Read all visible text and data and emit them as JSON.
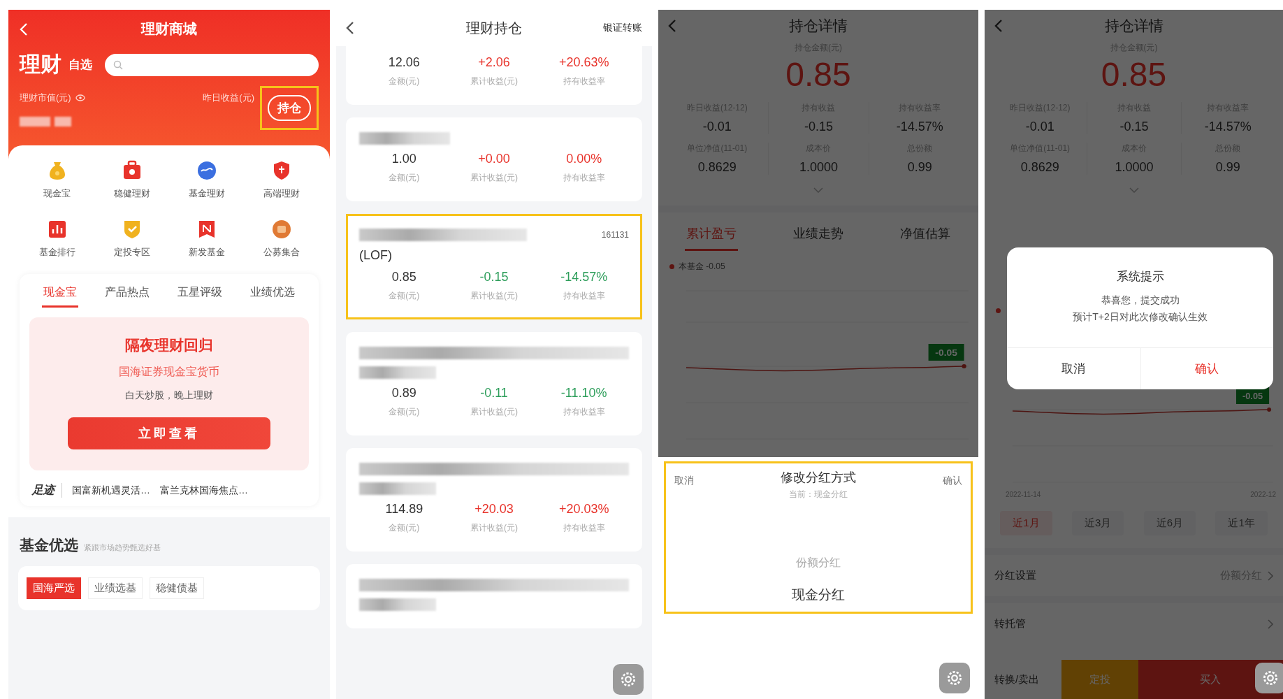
{
  "mall": {
    "title": "理财商城",
    "brand": "理财",
    "watchlist": "自选",
    "market_value_label": "理财市值(元)",
    "yesterday_label": "昨日收益(元)",
    "holdings_button": {
      "label": "持仓",
      "highlighted": true
    },
    "shortcuts": [
      "现金宝",
      "稳健理财",
      "基金理财",
      "高端理财",
      "基金排行",
      "定投专区",
      "新发基金",
      "公募集合"
    ],
    "tabs": [
      {
        "label": "现金宝",
        "selected": true
      },
      {
        "label": "产品热点",
        "selected": false
      },
      {
        "label": "五星评级",
        "selected": false
      },
      {
        "label": "业绩优选",
        "selected": false
      }
    ],
    "promo": {
      "title": "隔夜理财回归",
      "product": "国海证券现金宝货币",
      "slogan": "白天炒股，晚上理财",
      "button": "立即查看"
    },
    "footprints": {
      "label": "足迹",
      "items": [
        "国富新机遇灵活…",
        "富兰克林国海焦点…"
      ]
    },
    "section": {
      "title": "基金优选",
      "subtitle": "紧跟市场趋势甄选好基"
    },
    "chips": [
      {
        "label": "国海严选",
        "selected": true
      },
      {
        "label": "业绩选基",
        "selected": false
      },
      {
        "label": "稳健债基",
        "selected": false
      }
    ]
  },
  "holdings": {
    "title": "理财持仓",
    "action": "银证转账",
    "cards": [
      {
        "gain": true,
        "highlighted": false,
        "cells": [
          {
            "value": "12.06",
            "label": "金额(元)"
          },
          {
            "value": "+2.06",
            "label": "累计收益(元)"
          },
          {
            "value": "+20.63%",
            "label": "持有收益率"
          }
        ]
      },
      {
        "gain": true,
        "highlighted": false,
        "cells": [
          {
            "value": "1.00",
            "label": "金额(元)"
          },
          {
            "value": "+0.00",
            "label": "累计收益(元)"
          },
          {
            "value": "0.00%",
            "label": "持有收益率"
          }
        ]
      },
      {
        "code": "161131",
        "name_suffix": "(LOF)",
        "gain": false,
        "highlighted": true,
        "cells": [
          {
            "value": "0.85",
            "label": "金额(元)"
          },
          {
            "value": "-0.15",
            "label": "累计收益(元)"
          },
          {
            "value": "-14.57%",
            "label": "持有收益率"
          }
        ]
      },
      {
        "gain": false,
        "highlighted": false,
        "cells": [
          {
            "value": "0.89",
            "label": "金额(元)"
          },
          {
            "value": "-0.11",
            "label": "累计收益(元)"
          },
          {
            "value": "-11.10%",
            "label": "持有收益率"
          }
        ]
      },
      {
        "gain": true,
        "highlighted": false,
        "cells": [
          {
            "value": "114.89",
            "label": "金额(元)"
          },
          {
            "value": "+20.03",
            "label": "累计收益(元)"
          },
          {
            "value": "+20.03%",
            "label": "持有收益率"
          }
        ]
      },
      {
        "highlighted": false
      }
    ]
  },
  "detail_sheet": {
    "title": "持仓详情",
    "amount_label": "持仓金额(元)",
    "amount": "0.85",
    "stats": [
      {
        "label": "昨日收益(12-12)",
        "value": "-0.01"
      },
      {
        "label": "持有收益",
        "value": "-0.15"
      },
      {
        "label": "持有收益率",
        "value": "-14.57%"
      },
      {
        "label": "单位净值(11-01)",
        "value": "0.8629"
      },
      {
        "label": "成本价",
        "value": "1.0000"
      },
      {
        "label": "总份额",
        "value": "0.99"
      }
    ],
    "tabs": [
      {
        "label": "累计盈亏",
        "selected": true
      },
      {
        "label": "业绩走势",
        "selected": false
      },
      {
        "label": "净值估算",
        "selected": false
      }
    ],
    "legend": "本基金 -0.05",
    "tooltip": "-0.05",
    "sheet": {
      "cancel": "取消",
      "title": "修改分红方式",
      "current": "当前：现金分红",
      "confirm": "确认",
      "highlighted": true,
      "options": [
        {
          "label": "份额分红",
          "selected": false
        },
        {
          "label": "现金分红",
          "selected": true
        }
      ]
    }
  },
  "detail_dialog": {
    "title": "持仓详情",
    "amount_label": "持仓金额(元)",
    "amount": "0.85",
    "stats": [
      {
        "label": "昨日收益(12-12)",
        "value": "-0.01"
      },
      {
        "label": "持有收益",
        "value": "-0.15"
      },
      {
        "label": "持有收益率",
        "value": "-14.57%"
      },
      {
        "label": "单位净值(11-01)",
        "value": "0.8629"
      },
      {
        "label": "成本价",
        "value": "1.0000"
      },
      {
        "label": "总份额",
        "value": "0.99"
      }
    ],
    "tooltip": "-0.05",
    "dates": [
      "2022-11-14",
      "2022-12"
    ],
    "periods": [
      {
        "label": "近1月",
        "selected": true
      },
      {
        "label": "近3月",
        "selected": false
      },
      {
        "label": "近6月",
        "selected": false
      },
      {
        "label": "近1年",
        "selected": false
      }
    ],
    "rows": [
      {
        "label": "分红设置",
        "value": "份额分红"
      },
      {
        "label": "转托管"
      }
    ],
    "actions": [
      {
        "label": "转换/卖出",
        "kind": "plain"
      },
      {
        "label": "定投",
        "kind": "secondary"
      },
      {
        "label": "买入",
        "kind": "primary"
      }
    ],
    "dialog": {
      "title": "系统提示",
      "message": "恭喜您，提交成功",
      "note": "预计T+2日对此次修改确认生效",
      "cancel": "取消",
      "confirm": "确认"
    }
  }
}
